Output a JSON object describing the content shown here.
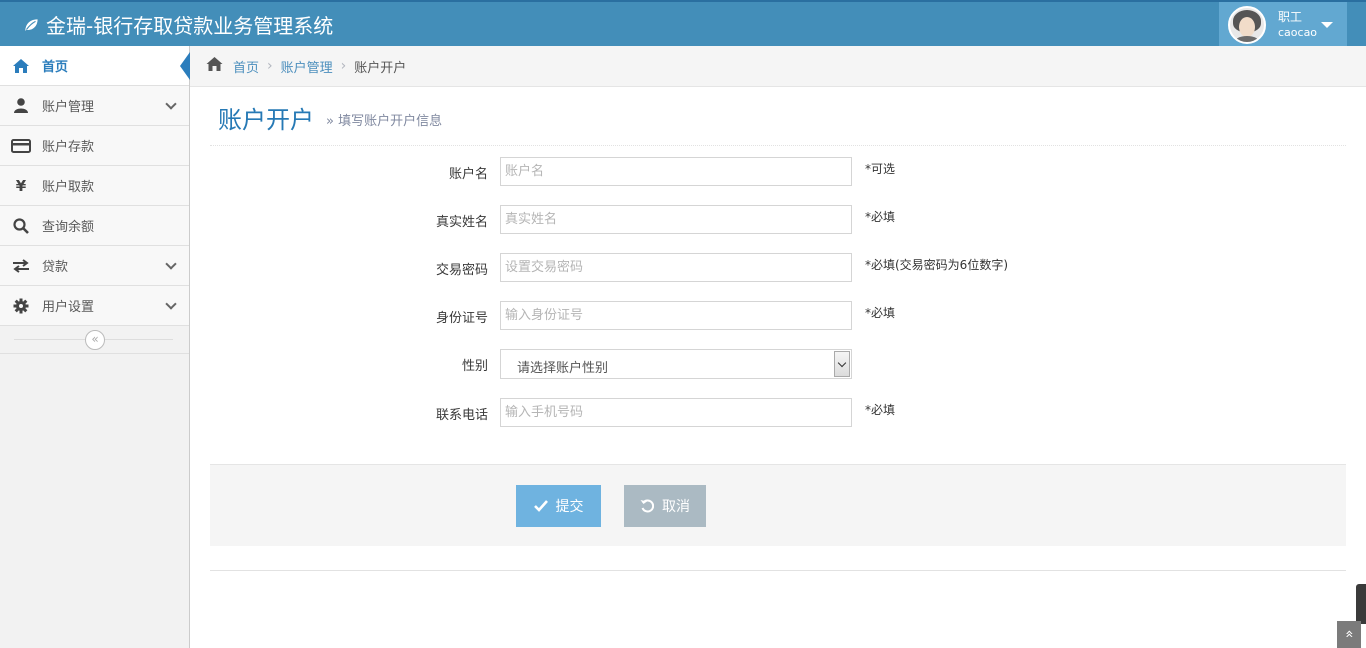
{
  "app": {
    "title": "金瑞-银行存取贷款业务管理系统"
  },
  "user": {
    "role": "职工",
    "username": "caocao"
  },
  "sidebar": {
    "items": [
      {
        "label": "首页",
        "icon": "home-icon"
      },
      {
        "label": "账户管理",
        "icon": "user-icon"
      },
      {
        "label": "账户存款",
        "icon": "credit-card-icon"
      },
      {
        "label": "账户取款",
        "icon": "yen-icon"
      },
      {
        "label": "查询余额",
        "icon": "search-icon"
      },
      {
        "label": "贷款",
        "icon": "exchange-icon"
      },
      {
        "label": "用户设置",
        "icon": "gear-icon"
      }
    ]
  },
  "breadcrumb": {
    "home": "首页",
    "section": "账户管理",
    "current": "账户开户"
  },
  "page": {
    "title": "账户开户",
    "subtitle": "» 填写账户开户信息"
  },
  "form": {
    "fields": [
      {
        "label": "账户名",
        "placeholder": "账户名",
        "help": "*可选"
      },
      {
        "label": "真实姓名",
        "placeholder": "真实姓名",
        "help": "*必填"
      },
      {
        "label": "交易密码",
        "placeholder": "设置交易密码",
        "help": "*必填(交易密码为6位数字)"
      },
      {
        "label": "身份证号",
        "placeholder": "输入身份证号",
        "help": "*必填"
      },
      {
        "label": "性别",
        "selected": "请选择账户性别",
        "help": ""
      },
      {
        "label": "联系电话",
        "placeholder": "输入手机号码",
        "help": "*必填"
      }
    ],
    "submit_label": "提交",
    "cancel_label": "取消"
  },
  "colors": {
    "navbar": "#438eb9",
    "accent": "#2b7dbc",
    "submit": "#6fb3e0",
    "cancel": "#abbac3"
  }
}
